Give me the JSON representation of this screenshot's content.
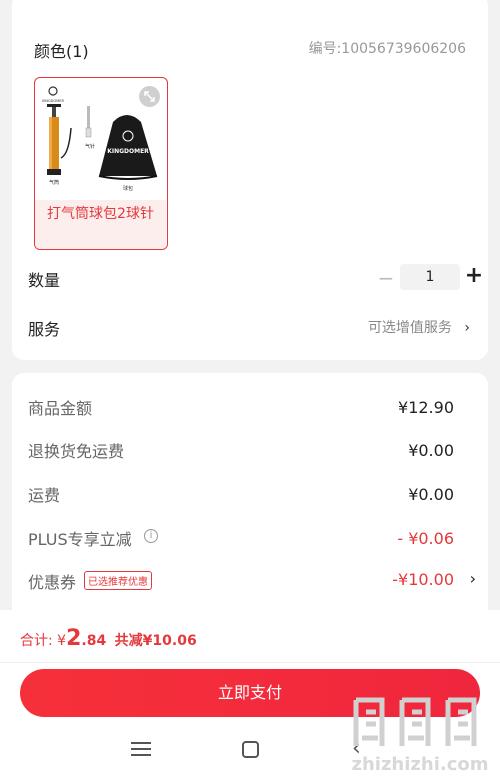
{
  "product": {
    "color_title": "颜色(1)",
    "sku_number": "编号:10056739606206",
    "variant_caption": "打气筒球包2球针",
    "image_labels": {
      "brand": "KINGDOMER",
      "bag_brand": "KINGDOMER",
      "pump": "气筒",
      "needle": "气针",
      "bag": "球包"
    }
  },
  "quantity": {
    "label": "数量",
    "minus": "−",
    "value": "1",
    "plus": "+"
  },
  "service": {
    "label": "服务",
    "value": "可选增值服务",
    "arrow": "›"
  },
  "fees": [
    {
      "label": "商品金额",
      "value": "¥12.90",
      "highlight": false
    },
    {
      "label": "退换货免运费",
      "value": "¥0.00",
      "highlight": false
    },
    {
      "label": "运费",
      "value": "¥0.00",
      "highlight": false
    },
    {
      "label": "PLUS专享立减",
      "value": "- ¥0.06",
      "highlight": true
    },
    {
      "label": "优惠券",
      "value": "-¥10.00",
      "highlight": true
    }
  ],
  "coupon_tag": "已选推荐优惠",
  "coupon_arrow": "›",
  "info_icon": "i",
  "footer": {
    "total_prefix": "合计: ¥",
    "total_int": "2",
    "total_dec": ".84",
    "saved": "共减¥10.06",
    "pay_button": "立即支付"
  },
  "nav": {
    "back": "‹"
  },
  "watermark": {
    "text": "zhizhizhi.com",
    "color": "#dddddd"
  },
  "colors": {
    "accent": "#e4393c",
    "pay_button": "#f0263d"
  }
}
